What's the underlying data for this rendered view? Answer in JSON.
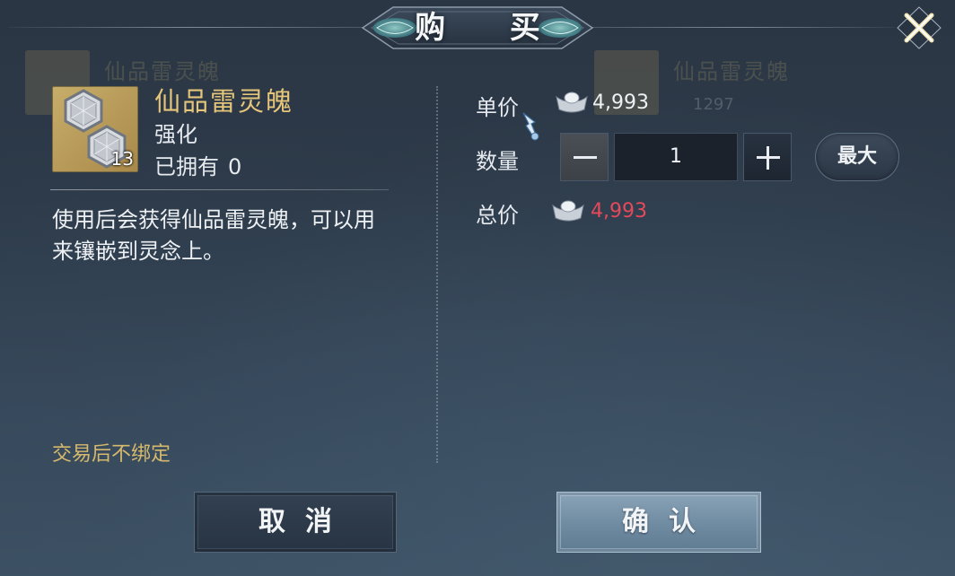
{
  "dialog": {
    "title": "购 买"
  },
  "item": {
    "name": "仙品雷灵魄",
    "type": "强化",
    "owned_label": "已拥有",
    "owned_count": "0",
    "stack_count": "13",
    "icon": "hexagon-crystal-icon",
    "description": "使用后会获得仙品雷灵魄，可以用来镶嵌到灵念上。",
    "bind_note": "交易后不绑定"
  },
  "purchase": {
    "unit_price_label": "单价",
    "unit_price": "4,993",
    "quantity_label": "数量",
    "quantity": "1",
    "max_label": "最大",
    "total_label": "总价",
    "total_price": "4,993",
    "currency_icon": "silver-ingot-icon"
  },
  "buttons": {
    "cancel": "取消",
    "confirm": "确认"
  },
  "background": {
    "ghost_left_name": "仙品雷灵魄",
    "ghost_right_name": "仙品雷灵魄",
    "ghost_right_sub": "1297"
  },
  "colors": {
    "item_name": "#e4c57a",
    "total_price": "#e5495a",
    "bind_note": "#d6b96c",
    "icon_bg": "#c7ad6a"
  }
}
